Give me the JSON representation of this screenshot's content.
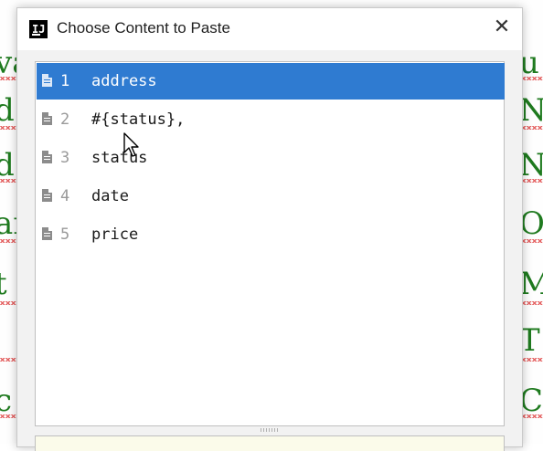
{
  "background_editor": {
    "left_fragments": [
      "va",
      "d",
      "d",
      "ar",
      "t",
      "c"
    ],
    "right_fragments": [
      "u",
      "NT",
      "NT",
      "ON",
      "MI",
      "T",
      "CO"
    ]
  },
  "dialog": {
    "title": "Choose Content to Paste",
    "app_icon_text": "IJ",
    "close_glyph": "✕"
  },
  "clipboard_items": [
    {
      "number": "1",
      "text": "address",
      "selected": true
    },
    {
      "number": "2",
      "text": "#{status},",
      "selected": false
    },
    {
      "number": "3",
      "text": "status",
      "selected": false
    },
    {
      "number": "4",
      "text": "date",
      "selected": false
    },
    {
      "number": "5",
      "text": "price",
      "selected": false
    }
  ],
  "colors": {
    "selection": "#2f7bd1",
    "code_text": "#1f7a1f",
    "error_squiggle": "#e04040"
  }
}
